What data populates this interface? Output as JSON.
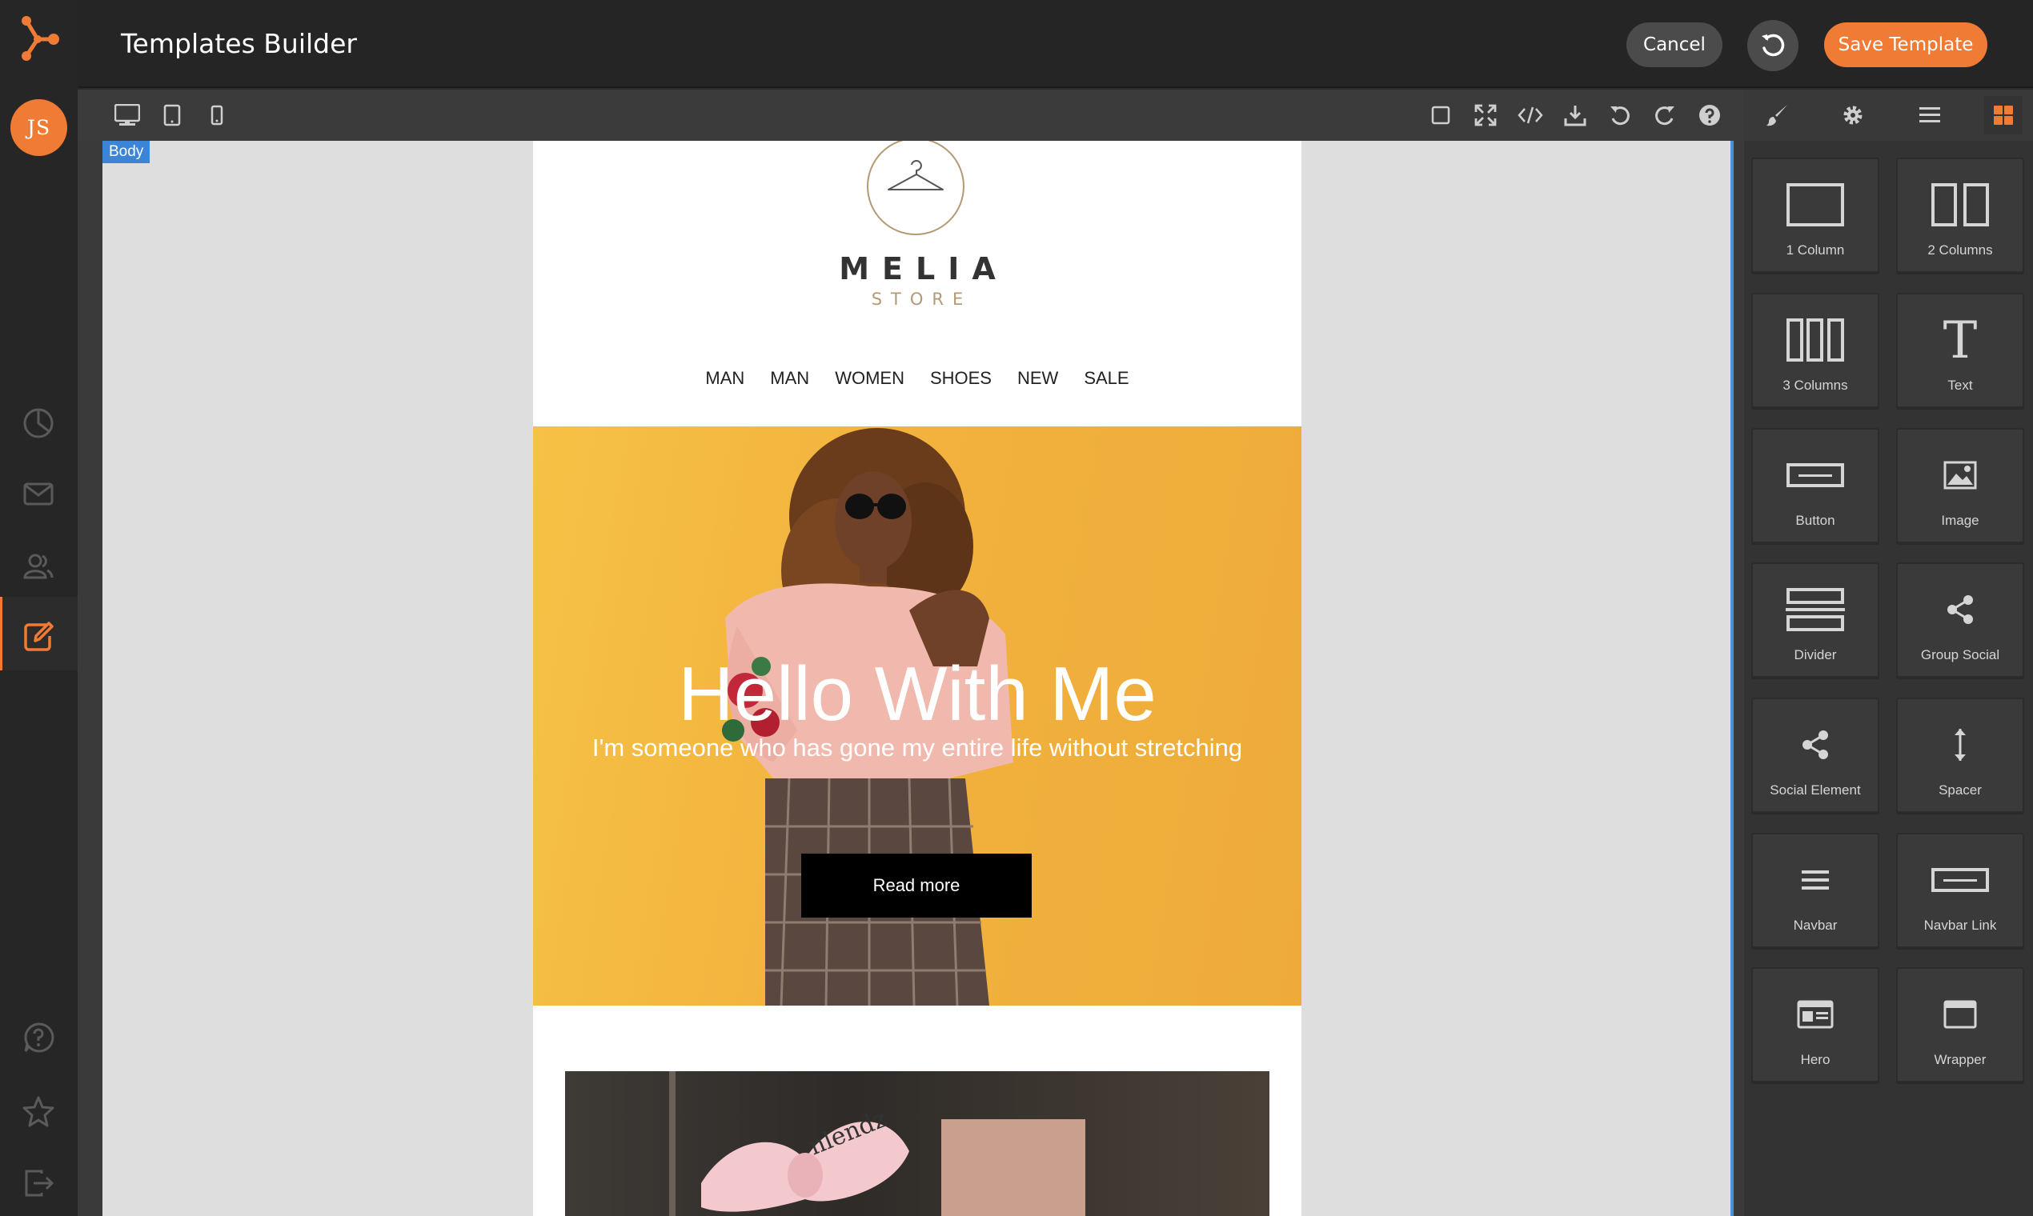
{
  "app": {
    "title": "Templates Builder"
  },
  "user": {
    "initials": "JS"
  },
  "header": {
    "cancel_label": "Cancel",
    "save_label": "Save Template"
  },
  "canvas": {
    "selected_badge": "Body"
  },
  "email": {
    "brand": "MELIA",
    "brand_sub": "STORE",
    "nav": [
      "MAN",
      "MAN",
      "WOMEN",
      "SHOES",
      "NEW",
      "SALE"
    ],
    "hero_title": "Hello With Me",
    "hero_subtitle": "I'm someone who has gone my entire life without stretching",
    "hero_button": "Read more",
    "photo2_overlay_text": "nlendz"
  },
  "blocks": [
    {
      "label": "1 Column",
      "icon": "one-column-icon"
    },
    {
      "label": "2 Columns",
      "icon": "two-columns-icon"
    },
    {
      "label": "3 Columns",
      "icon": "three-columns-icon"
    },
    {
      "label": "Text",
      "icon": "text-icon"
    },
    {
      "label": "Button",
      "icon": "button-icon"
    },
    {
      "label": "Image",
      "icon": "image-icon"
    },
    {
      "label": "Divider",
      "icon": "divider-icon"
    },
    {
      "label": "Group Social",
      "icon": "share-icon"
    },
    {
      "label": "Social Element",
      "icon": "share-icon"
    },
    {
      "label": "Spacer",
      "icon": "spacer-icon"
    },
    {
      "label": "Navbar",
      "icon": "navbar-icon"
    },
    {
      "label": "Navbar Link",
      "icon": "navbar-link-icon"
    },
    {
      "label": "Hero",
      "icon": "hero-icon"
    },
    {
      "label": "Wrapper",
      "icon": "wrapper-icon"
    }
  ],
  "colors": {
    "accent": "#ef7b35",
    "selection": "#3b84d6",
    "hero_bg": "#f2b23d"
  }
}
